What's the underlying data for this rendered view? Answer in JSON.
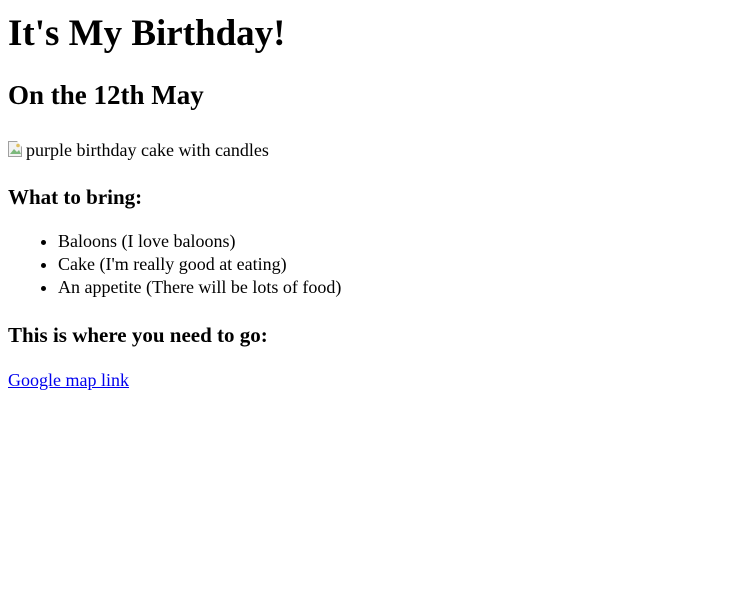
{
  "header": {
    "title": "It's My Birthday!",
    "date": "On the 12th May"
  },
  "image": {
    "alt": "purple birthday cake with candles",
    "icon": "broken-image-icon"
  },
  "bring": {
    "heading": "What to bring:",
    "items": [
      "Baloons (I love baloons)",
      "Cake (I'm really good at eating)",
      "An appetite (There will be lots of food)"
    ]
  },
  "location": {
    "heading": "This is where you need to go:",
    "link_text": "Google map link",
    "link_color": "#0000ee"
  }
}
